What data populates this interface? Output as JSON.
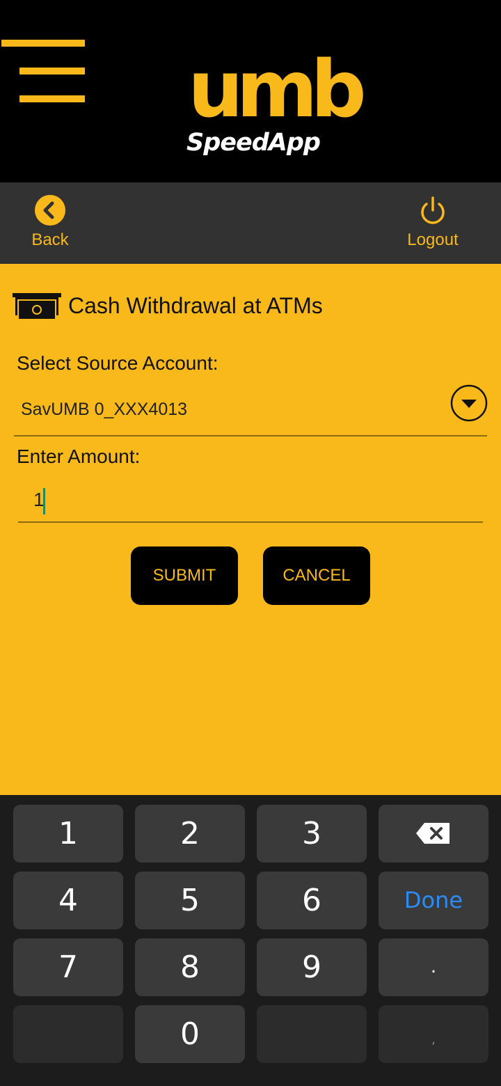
{
  "header": {
    "logo_mark": "umb",
    "logo_sub": "SpeedApp"
  },
  "actionbar": {
    "back_label": "Back",
    "logout_label": "Logout"
  },
  "form": {
    "title": "Cash Withdrawal at ATMs",
    "source_label": "Select Source Account:",
    "source_value": "SavUMB 0_XXX4013",
    "amount_label": "Enter Amount:",
    "amount_value": "1",
    "submit_label": "SUBMIT",
    "cancel_label": "CANCEL"
  },
  "keyboard": {
    "keys": [
      "1",
      "2",
      "3",
      "4",
      "5",
      "6",
      "7",
      "8",
      "9",
      "0"
    ],
    "done_label": "Done",
    "dot_label": ".",
    "comma_label": ","
  },
  "colors": {
    "brand_yellow": "#F9B91A",
    "header_bg": "#000000",
    "actionbar_bg": "#323232",
    "keyboard_bg": "#1C1C1C",
    "done_blue": "#2C8CF4"
  },
  "icons": {
    "menu": "hamburger-menu-icon",
    "back": "back-chevron-icon",
    "logout": "power-icon",
    "title": "cash-icon",
    "dropdown": "chevron-down-icon",
    "backspace": "backspace-icon"
  }
}
